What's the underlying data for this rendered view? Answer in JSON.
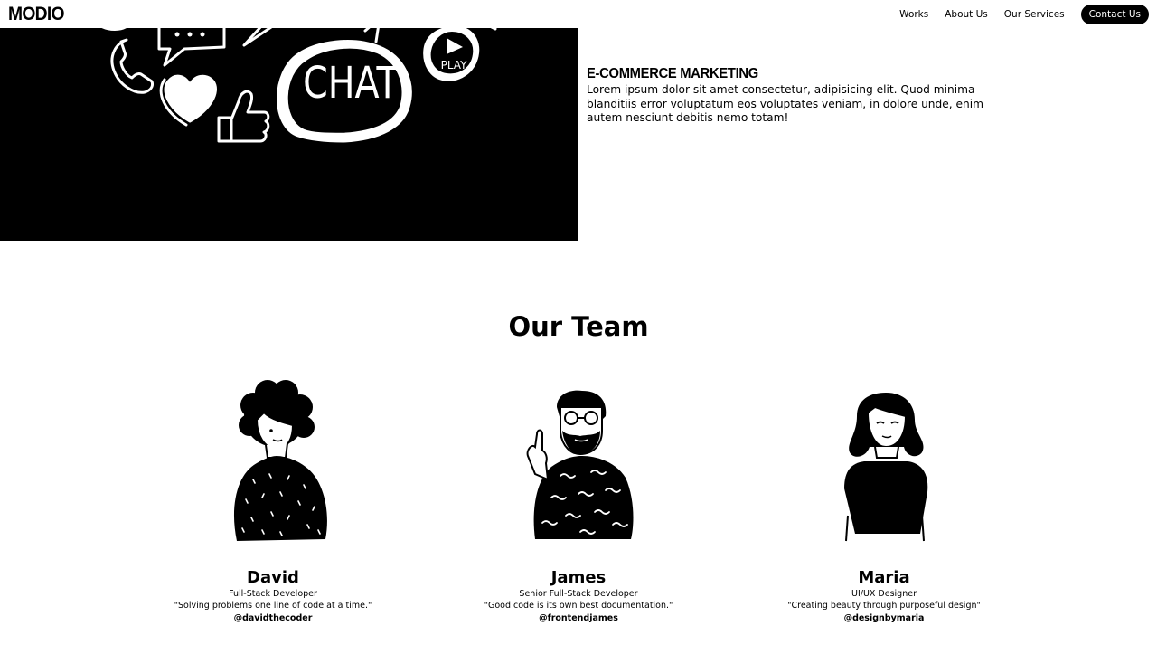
{
  "nav": {
    "logo": "MODIO",
    "links": [
      "Works",
      "About Us",
      "Our Services"
    ],
    "contact": "Contact Us"
  },
  "hero": {
    "chat_text": "CHAT",
    "play_text": "PLAY"
  },
  "service": {
    "title": "E-COMMERCE MARKETING",
    "description": "Lorem ipsum dolor sit amet consectetur, adipisicing elit. Quod minima blanditiis error voluptatum eos voluptates veniam, in dolore unde, enim autem nesciunt debitis nemo totam!"
  },
  "team": {
    "heading": "Our Team",
    "members": [
      {
        "name": "David",
        "role": "Full-Stack Developer",
        "quote": "\"Solving problems one line of code at a time.\"",
        "handle": "@davidthecoder"
      },
      {
        "name": "James",
        "role": "Senior Full-Stack Developer",
        "quote": "\"Good code is its own best documentation.\"",
        "handle": "@frontendjames"
      },
      {
        "name": "Maria",
        "role": "UI/UX Designer",
        "quote": "\"Creating beauty through purposeful design\"",
        "handle": "@designbymaria"
      }
    ]
  }
}
